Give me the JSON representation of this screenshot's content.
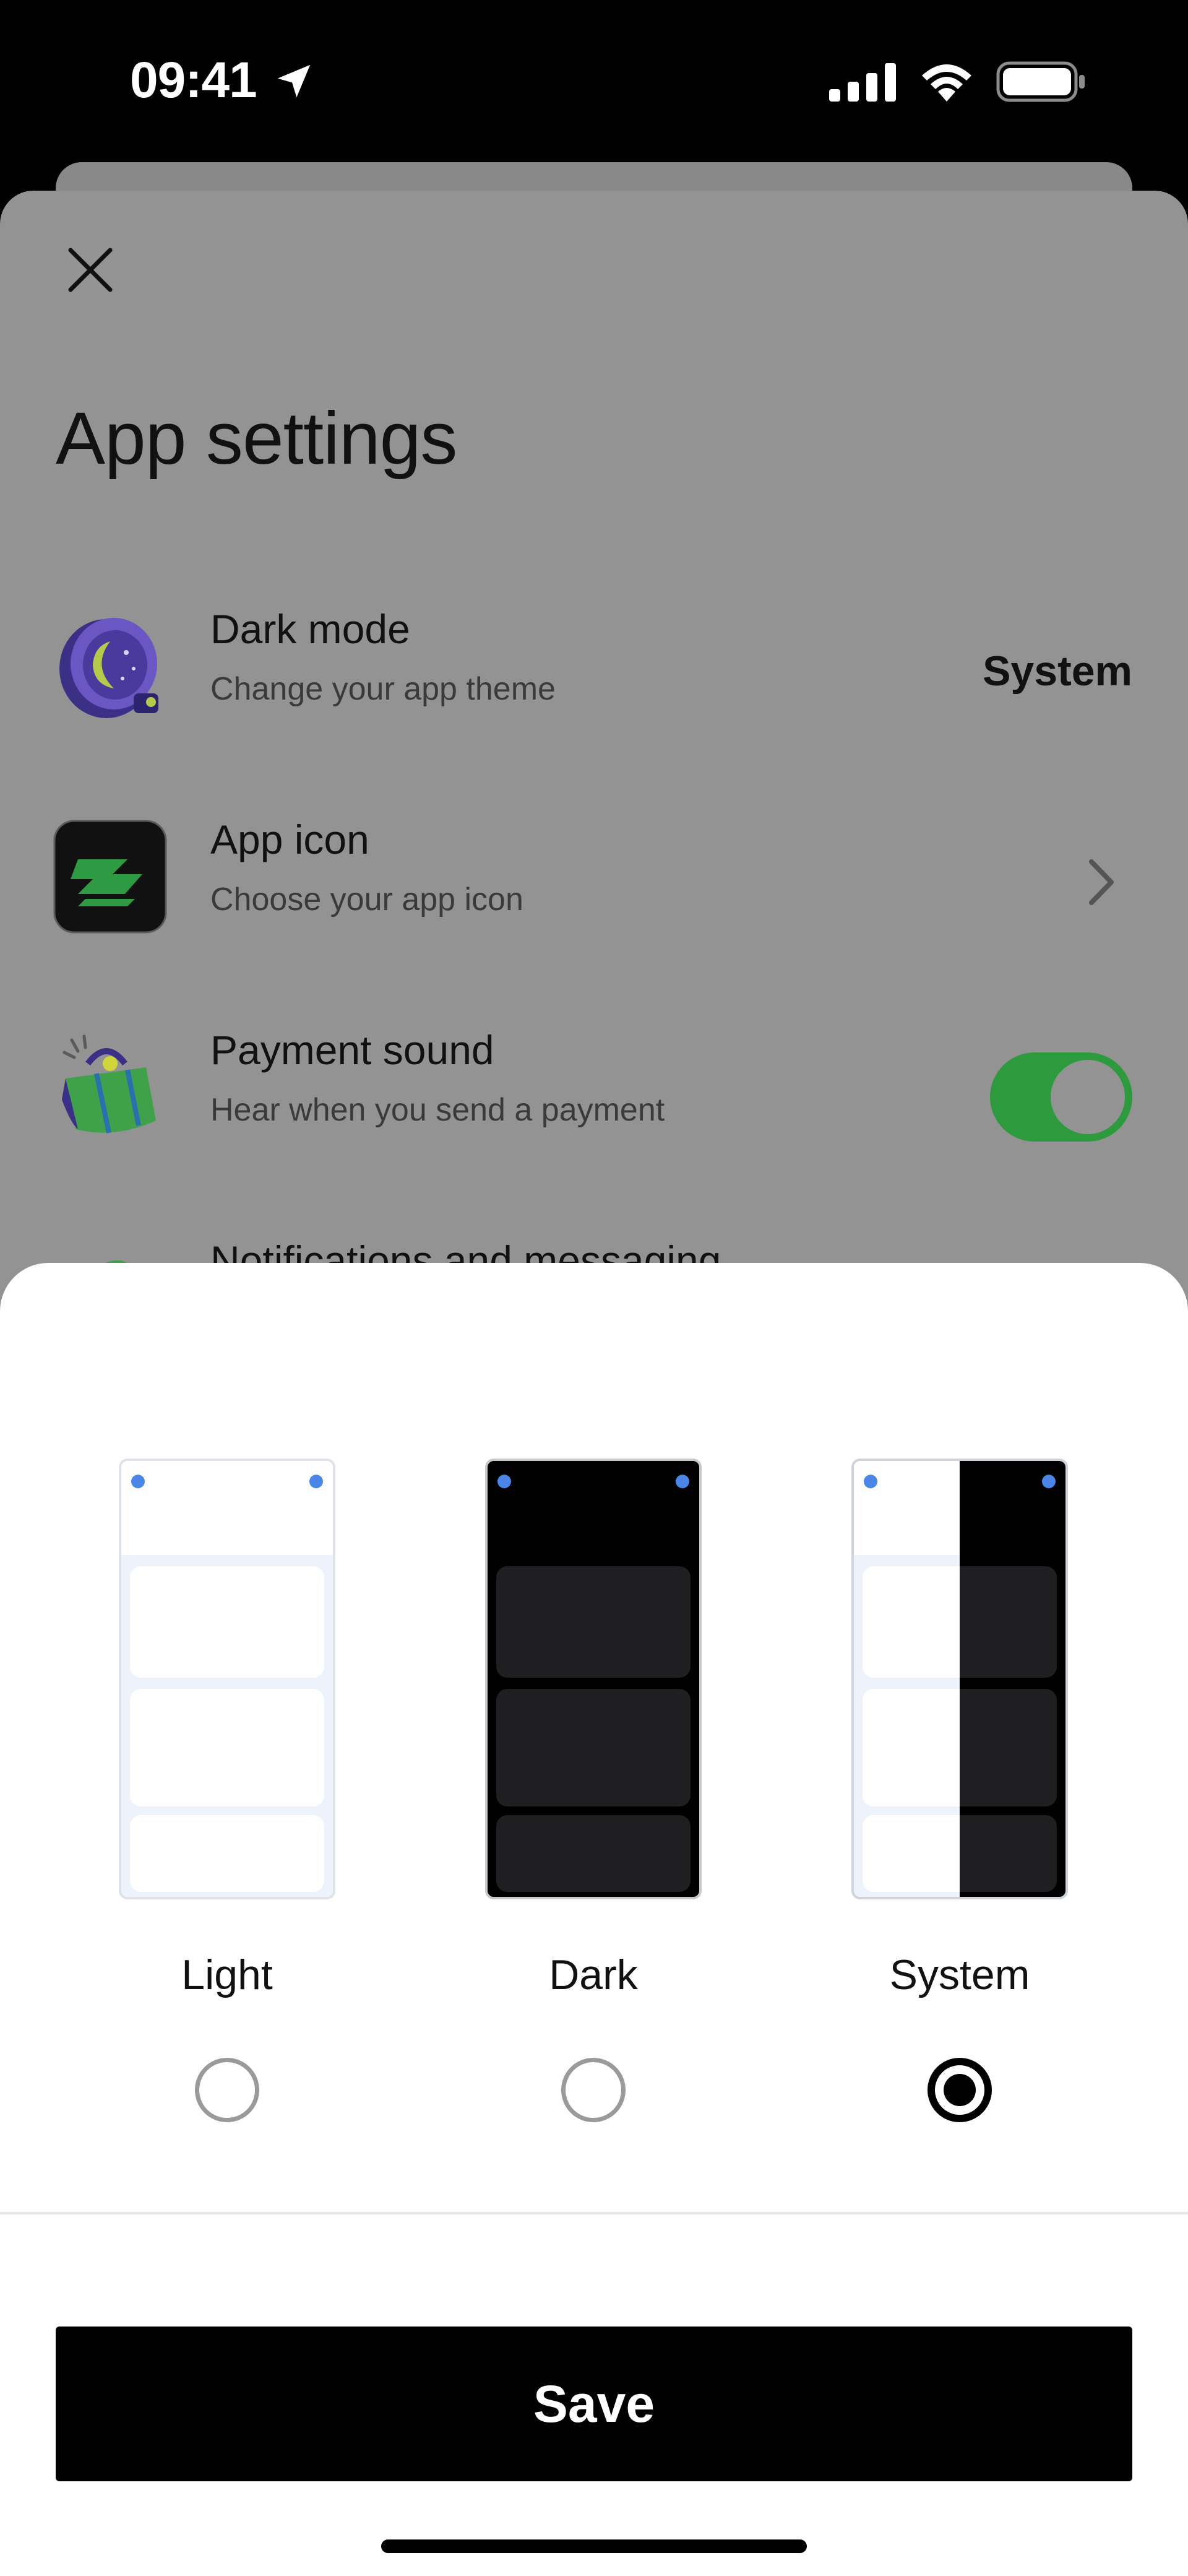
{
  "status_bar": {
    "time": "09:41",
    "icons": [
      "location-arrow-icon",
      "cellular-signal-icon",
      "wifi-icon",
      "battery-icon"
    ]
  },
  "settings": {
    "title": "App settings",
    "rows": [
      {
        "title": "Dark mode",
        "subtitle": "Change your app theme",
        "value": "System",
        "icon": "moon-clock-icon"
      },
      {
        "title": "App icon",
        "subtitle": "Choose your app icon",
        "icon": "app-icon-preview-icon"
      },
      {
        "title": "Payment sound",
        "subtitle": "Hear when you send a payment",
        "icon": "shopping-bag-icon",
        "toggle_on": true
      },
      {
        "title": "Notifications and messaging",
        "icon": "notification-icon"
      }
    ]
  },
  "theme_picker": {
    "options": [
      {
        "label": "Light",
        "selected": false
      },
      {
        "label": "Dark",
        "selected": false
      },
      {
        "label": "System",
        "selected": true
      }
    ],
    "save_label": "Save"
  },
  "colors": {
    "toggle_on": "#2D9A3D",
    "overlay_dim": "#939393",
    "preview_dot": "#4A86E8",
    "primary_button": "#000000"
  }
}
